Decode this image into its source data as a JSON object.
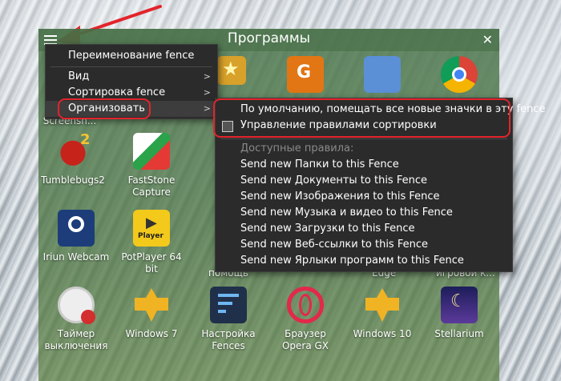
{
  "fence": {
    "title": "Программы",
    "close_glyph": "✕"
  },
  "tiles": [
    {
      "label": "Screensh...",
      "icon": "screenshot-icon"
    },
    {
      "label": "Tumblebugs2",
      "icon": "ladybug-game-icon"
    },
    {
      "label": "FastStone Capture",
      "icon": "faststone-capture-icon"
    },
    {
      "label": "Iriun Webcam",
      "icon": "webcam-icon"
    },
    {
      "label": "PotPlayer 64 bit",
      "icon": "potplayer-icon",
      "badge": "Player"
    },
    {
      "label": "Таймер выключения",
      "icon": "timer-icon"
    },
    {
      "label": "Windows 7",
      "icon": "windows7-shortcut-icon"
    },
    {
      "label": "Настройка Fences",
      "icon": "fences-settings-icon"
    },
    {
      "label": "Браузер Opera GX",
      "icon": "opera-gx-icon"
    },
    {
      "label": "Windows 10",
      "icon": "windows10-shortcut-icon"
    },
    {
      "label": "Stellarium",
      "icon": "stellarium-icon"
    },
    {
      "label": "Edge",
      "icon": "edge-icon"
    },
    {
      "label": "игровой к...",
      "icon": "game-mode-icon"
    },
    {
      "label": "помощь",
      "icon": "help-icon"
    }
  ],
  "menu": {
    "items": [
      {
        "label": "Переименование fence",
        "has_submenu": false
      },
      {
        "label": "Вид",
        "has_submenu": true
      },
      {
        "label": "Сортировка fence",
        "has_submenu": true
      },
      {
        "label": "Организовать",
        "has_submenu": true,
        "highlighted": true
      }
    ]
  },
  "submenu": {
    "items": [
      {
        "label": "По умолчанию, помещать все новые значки в эту fence"
      },
      {
        "label": "Управление правилами сортировки",
        "icon": "sort-rules-icon"
      }
    ],
    "section_header": "Доступные правила:",
    "rules": [
      "Send new Папки to this Fence",
      "Send new Документы to this Fence",
      "Send new Изображения to this Fence",
      "Send new Музыка и видео to this Fence",
      "Send new Загрузки to this Fence",
      "Send new Веб-ссылки to this Fence",
      "Send new Ярлыки программ to this Fence"
    ]
  },
  "colors": {
    "highlight_red": "#e3242b",
    "menu_bg": "#2b2b2b",
    "fence_green": "#4e7a4e"
  }
}
